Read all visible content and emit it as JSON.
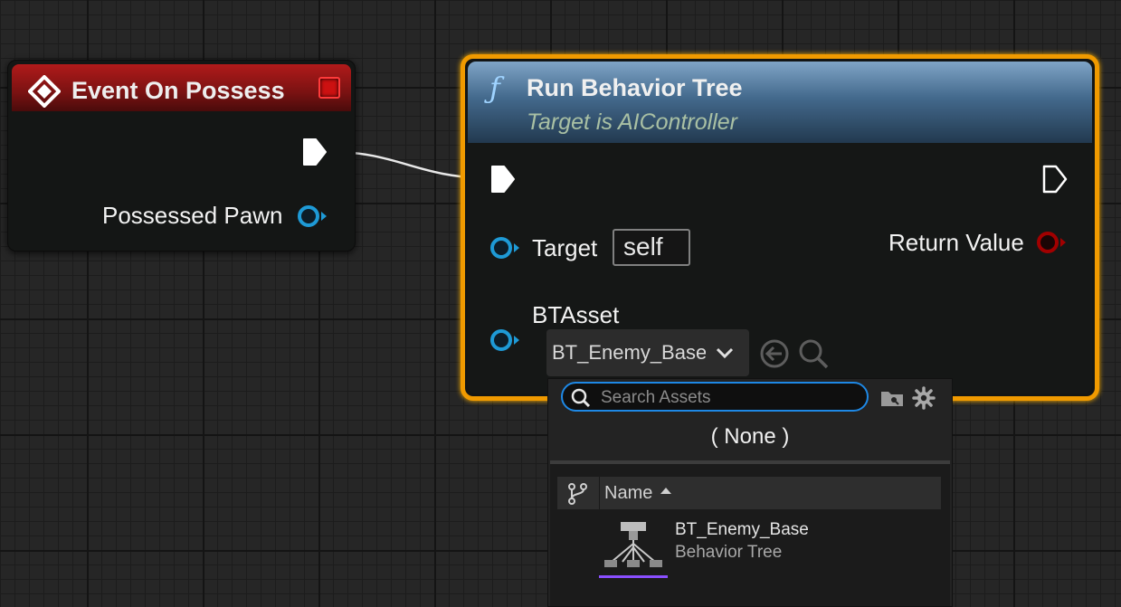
{
  "event_node": {
    "title": "Event On Possess",
    "icon": "event-diamond-icon",
    "pins": {
      "exec_out": "exec-pin-icon",
      "possessed_pawn_label": "Possessed Pawn"
    },
    "header_color": "#9b1717"
  },
  "function_node": {
    "icon": "function-f-icon",
    "icon_glyph": "ƒ",
    "title": "Run Behavior Tree",
    "subtitle": "Target is AIController",
    "highlight_color": "#f09a00",
    "header_color": "#43698c",
    "pins": {
      "target_label": "Target",
      "target_value": "self",
      "return_label": "Return Value",
      "bt_asset_label": "BTAsset"
    },
    "asset_combo": {
      "selected": "BT_Enemy_Base",
      "browse_icon": "arrow-left-circle-icon",
      "find_icon": "magnifier-icon"
    }
  },
  "asset_picker": {
    "search": {
      "placeholder": "Search Assets",
      "value": ""
    },
    "none_option": "( None )",
    "columns": {
      "name": "Name",
      "sort": "ascending"
    },
    "assets": [
      {
        "name": "BT_Enemy_Base",
        "type": "Behavior Tree",
        "underline_color": "#8a4fff"
      }
    ]
  },
  "colors": {
    "object_pin": "#1e9ad6",
    "return_pin": "#a10000",
    "wire": "#e6e6e6"
  }
}
